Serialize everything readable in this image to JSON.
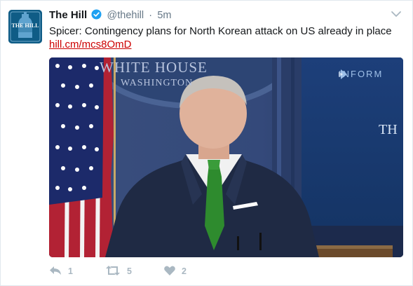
{
  "tweet": {
    "author_name": "The Hill",
    "handle": "@thehill",
    "separator": "·",
    "time": "5m",
    "text": "Spicer: Contingency plans for North Korean attack on US already in place",
    "link": "hill.cm/mcs8OmD",
    "avatar_text": "THE HILL"
  },
  "media": {
    "backdrop_text": "WHITE HOUSE",
    "backdrop_subtext": "WASHINGTON",
    "screen_brand": "INFORM",
    "screen_text": "TH"
  },
  "actions": {
    "reply_count": "1",
    "retweet_count": "5",
    "like_count": "2"
  },
  "icons": {
    "verified": "verified-badge-icon",
    "caret": "chevron-down-icon",
    "reply": "reply-icon",
    "retweet": "retweet-icon",
    "like": "heart-icon"
  },
  "colors": {
    "link": "#cc0000",
    "verified": "#1da1f2",
    "action_gray": "#aab8c2",
    "avatar_bg": "#0f5c86"
  }
}
